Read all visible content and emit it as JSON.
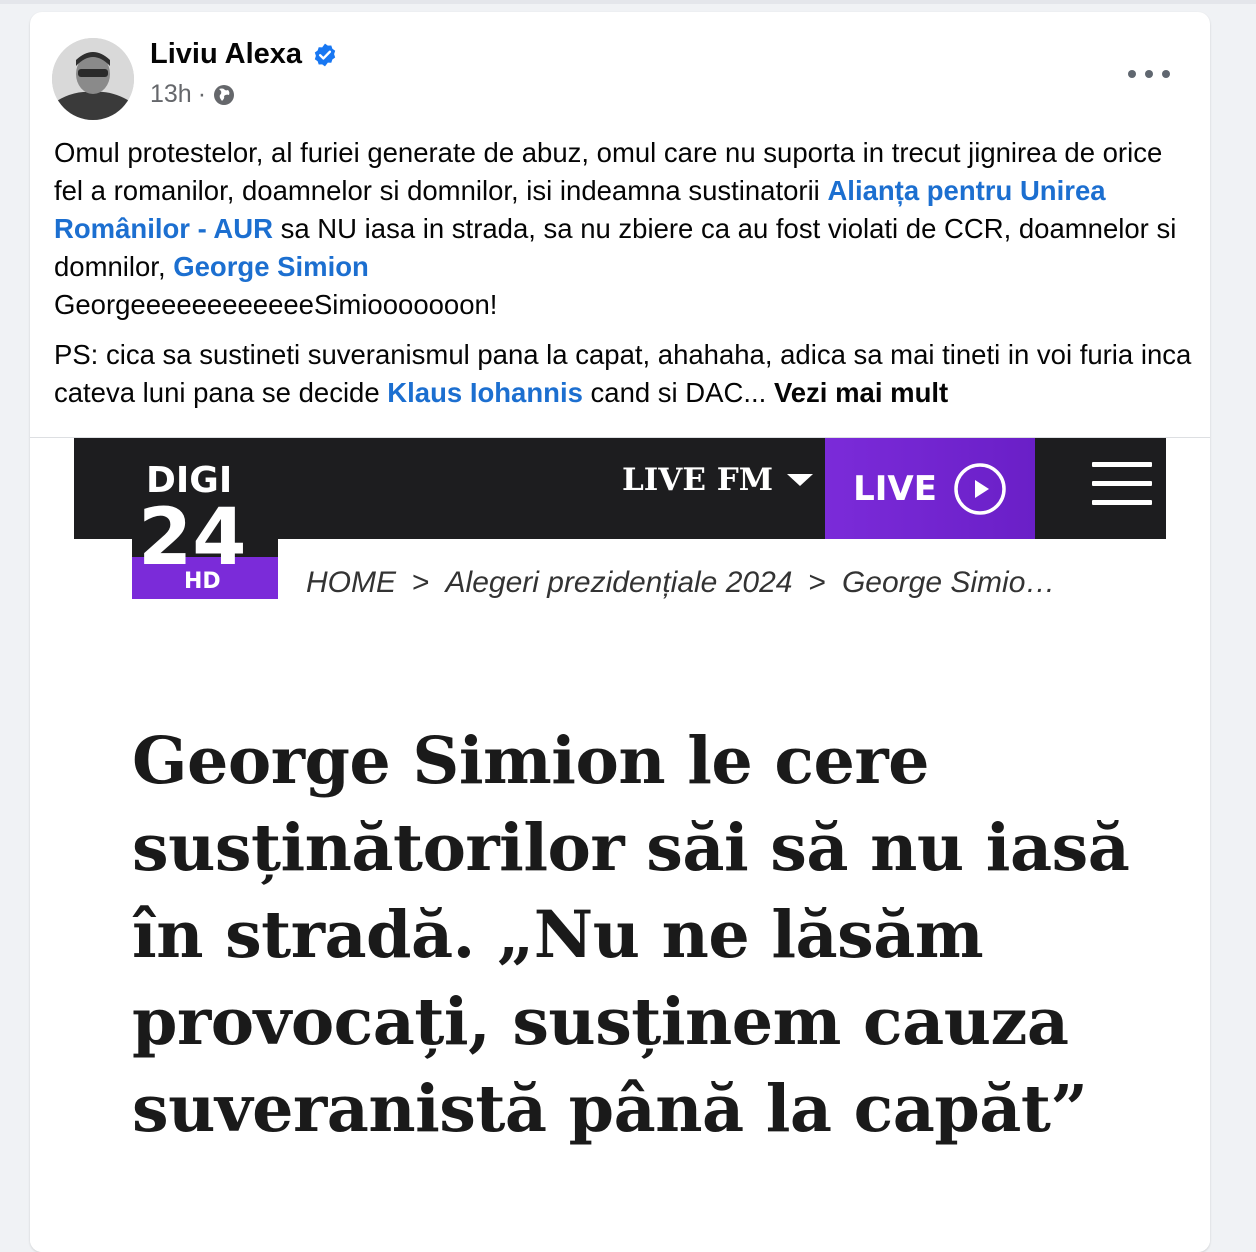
{
  "post": {
    "author": "Liviu Alexa",
    "time": "13h",
    "dot": "·",
    "paragraph1": {
      "t1": "Omul protestelor, al furiei generate de abuz, omul care nu suporta in trecut jignirea de orice fel a romanilor, doamnelor si domnilor, isi indeamna sustinatorii ",
      "mention1": "Alianța pentru Unirea Românilor - AUR",
      "t2": " sa NU iasa in strada, sa nu zbiere ca au fost violati de CCR, doamnelor si domnilor, ",
      "mention2": "George Simion",
      "t3": "GeorgeeeeeeeeeeeeSimiooooooon!"
    },
    "paragraph2": {
      "t1": "PS: cica sa sustineti suveranismul pana la capat, ahahaha, adica sa mai tineti in voi furia inca cateva luni pana se decide ",
      "mention": "Klaus Iohannis",
      "t2": " cand si DAC... ",
      "see_more": "Vezi mai mult"
    }
  },
  "article": {
    "nav": {
      "live_fm": "LIVE FM",
      "live": "LIVE"
    },
    "logo": {
      "line1": "DIGI",
      "line2": "24",
      "hd": "HD"
    },
    "breadcrumb": [
      "HOME",
      ">",
      "Alegeri prezidențiale 2024",
      ">",
      "George Simio…"
    ],
    "headline": "George Simion le cere susținătorilor săi să nu iasă în stradă. „Nu ne lăsăm provocați, susținem cauza suveranistă până la capăt”"
  },
  "colors": {
    "link": "#1c6fd0",
    "verified": "#1877f2",
    "live_purple": "#7b2bd9",
    "bar_dark": "#1d1d1f"
  },
  "icons": [
    "verified-badge-icon",
    "globe-icon",
    "more-options-icon",
    "caret-down-icon",
    "play-icon",
    "hamburger-menu-icon"
  ]
}
